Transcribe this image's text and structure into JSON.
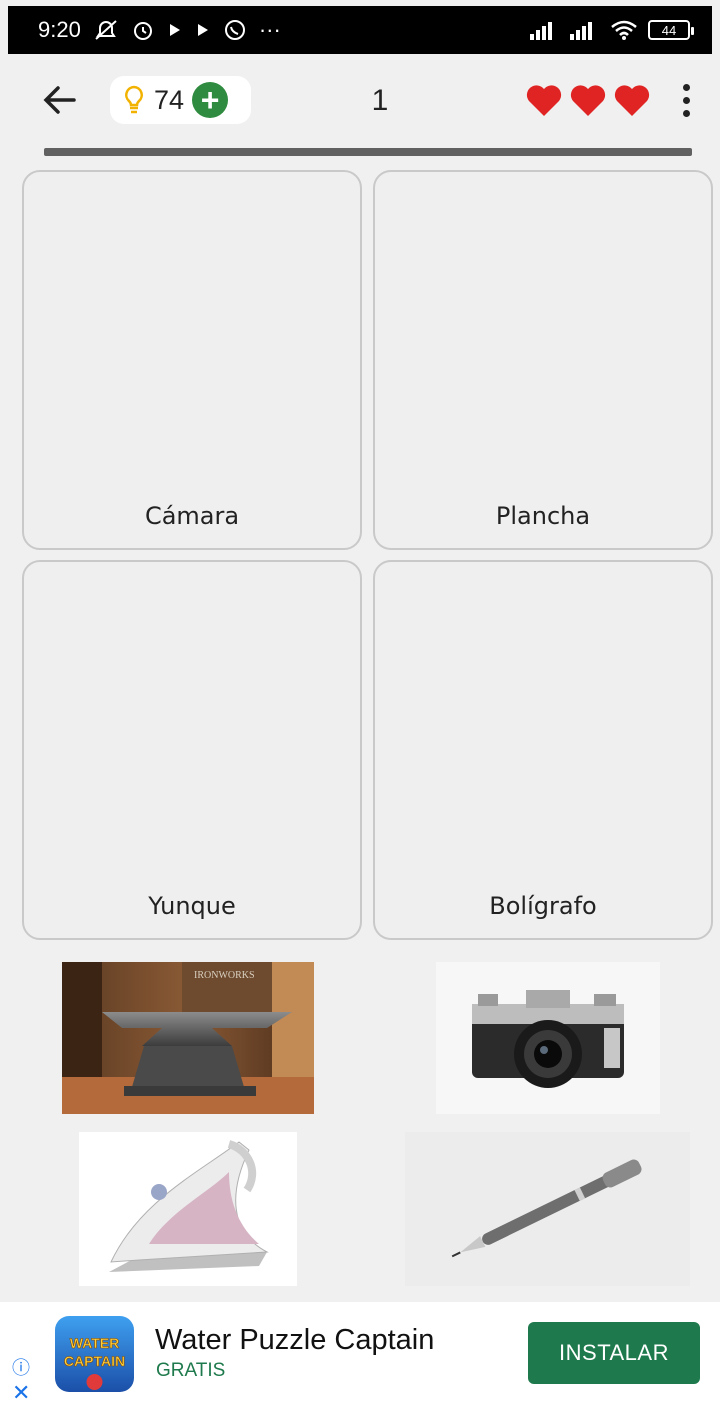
{
  "status_bar": {
    "time": "9:20",
    "icons": [
      "notifications-muted-icon",
      "alarm-icon",
      "play-icon",
      "play-icon",
      "whatsapp-icon",
      "more-icon"
    ],
    "more": "···",
    "battery": "44"
  },
  "header": {
    "hints": "74",
    "level": "1",
    "lives": 3
  },
  "cards": [
    {
      "label": "Cámara"
    },
    {
      "label": "Plancha"
    },
    {
      "label": "Yunque"
    },
    {
      "label": "Bolígrafo"
    }
  ],
  "anvil_text": "IRONWORKS",
  "ad": {
    "title": "Water Puzzle Captain",
    "subtitle": "GRATIS",
    "install_label": "INSTALAR",
    "icon_text_top": "WATER",
    "icon_text_bottom": "CAPTAIN"
  },
  "colors": {
    "accent_green": "#1e7a4c",
    "heart_red": "#e02424",
    "hint_yellow": "#f2b200"
  }
}
